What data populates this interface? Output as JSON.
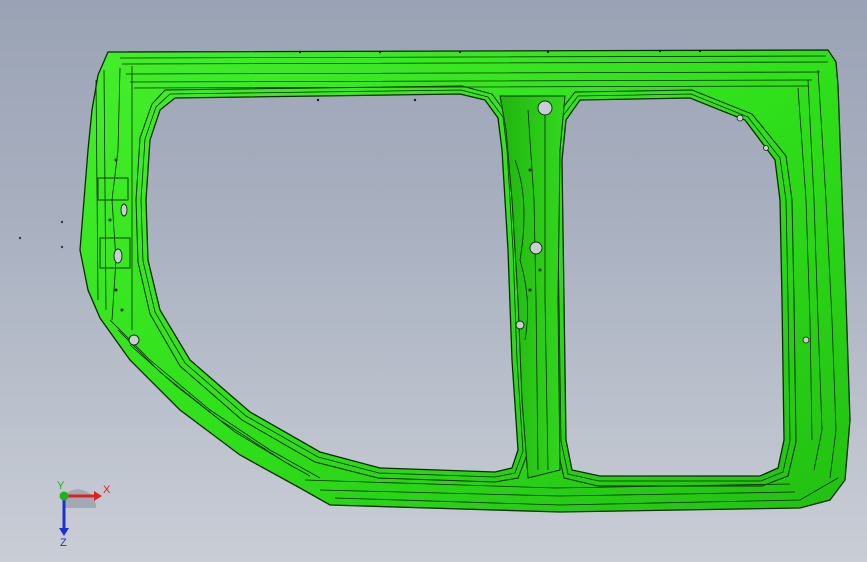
{
  "viewport": {
    "background_top": "#9aa3b5",
    "background_bottom": "#c9cdd6"
  },
  "model": {
    "part": "door-frame-panel",
    "face_color": "#2fe01a",
    "face_shade": "#1fb50f",
    "edge_color": "#0d2a08"
  },
  "triad": {
    "x_label": "X",
    "y_label": "Y",
    "z_label": "Z",
    "x_color": "#e02020",
    "y_color": "#20b020",
    "z_color": "#2030d0"
  }
}
